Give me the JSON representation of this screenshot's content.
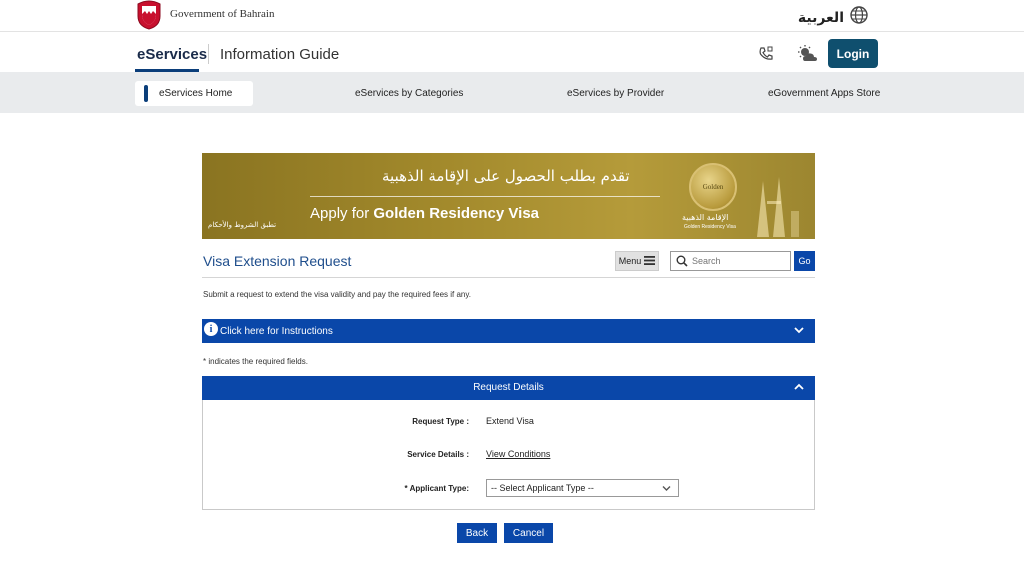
{
  "topbar": {
    "gov_label": "Government of Bahrain",
    "language_label": "العربية",
    "language_icon": "globe-icon",
    "logo_icon": "bahrain-emblem-icon"
  },
  "header": {
    "tab_eservices": "eServices",
    "tab_info": "Information Guide",
    "phone_icon": "phone-icon",
    "weather_icon": "weather-icon",
    "login_label": "Login"
  },
  "nav": {
    "items": [
      {
        "label": "eServices Home",
        "active": true
      },
      {
        "label": "eServices by Categories",
        "active": false
      },
      {
        "label": "eServices by Provider",
        "active": false
      },
      {
        "label": "eGovernment Apps Store",
        "active": false
      }
    ]
  },
  "banner": {
    "arabic_headline": "تقدم بطلب الحصول على الإقامة الذهبية",
    "english_prefix": "Apply for ",
    "english_bold": "Golden Residency Visa",
    "arabic_small": "تطبق الشروط والأحكام",
    "badge_text": "Golden",
    "badge_arabic": "الإقامة الذهبية",
    "badge_english": "Golden Residency Visa"
  },
  "page": {
    "title": "Visa Extension Request",
    "menu_label": "Menu",
    "search_placeholder": "Search",
    "go_label": "Go",
    "description": "Submit a request to extend the visa validity and pay the required fees if any.",
    "instructions_label": "Click here for Instructions",
    "required_note": "* indicates the required fields."
  },
  "request_details": {
    "header": "Request Details",
    "request_type_label": "Request Type :",
    "request_type_value": "Extend Visa",
    "service_details_label": "Service Details :",
    "service_details_link": "View Conditions",
    "applicant_type_label": "* Applicant Type:",
    "applicant_type_selected": "-- Select Applicant Type --"
  },
  "actions": {
    "back_label": "Back",
    "cancel_label": "Cancel"
  },
  "colors": {
    "primary_blue": "#0a47a9",
    "login_teal": "#0f4f6e",
    "nav_bg": "#e9ebed",
    "title_blue": "#1f4e8c",
    "banner_gold": "#a38a2c"
  }
}
